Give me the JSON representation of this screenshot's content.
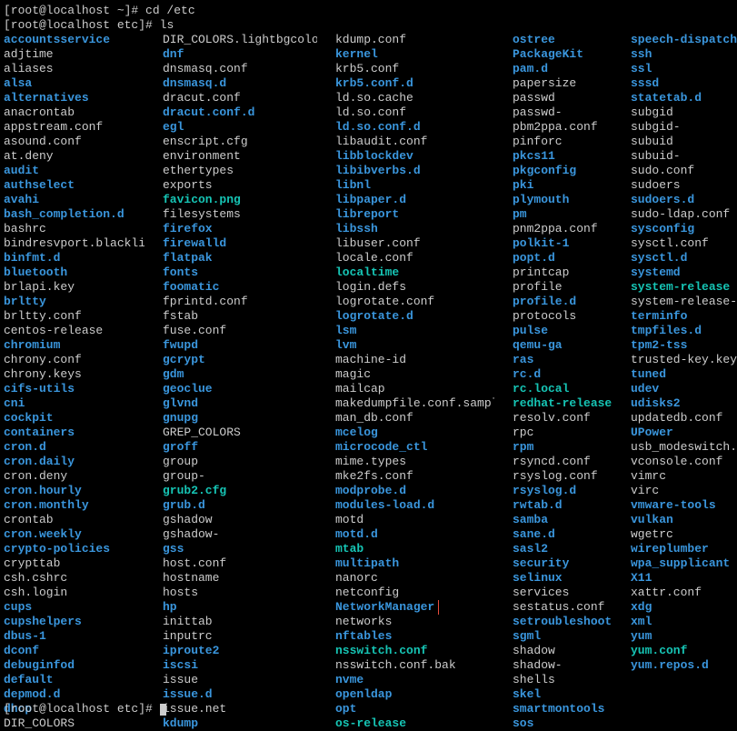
{
  "prompts": {
    "line1": "[root@localhost ~]# ",
    "cmd1": "cd /etc",
    "line2": "[root@localhost etc]# ",
    "cmd2": "ls",
    "line3": "[root@localhost etc]# "
  },
  "columns": [
    [
      {
        "name": "accountsservice",
        "cls": "dir"
      },
      {
        "name": "adjtime",
        "cls": "file"
      },
      {
        "name": "aliases",
        "cls": "file"
      },
      {
        "name": "alsa",
        "cls": "dir"
      },
      {
        "name": "alternatives",
        "cls": "dir"
      },
      {
        "name": "anacrontab",
        "cls": "file"
      },
      {
        "name": "appstream.conf",
        "cls": "file"
      },
      {
        "name": "asound.conf",
        "cls": "file"
      },
      {
        "name": "at.deny",
        "cls": "file"
      },
      {
        "name": "audit",
        "cls": "dir"
      },
      {
        "name": "authselect",
        "cls": "dir"
      },
      {
        "name": "avahi",
        "cls": "dir"
      },
      {
        "name": "bash_completion.d",
        "cls": "dir"
      },
      {
        "name": "bashrc",
        "cls": "file"
      },
      {
        "name": "bindresvport.blacklist",
        "cls": "file"
      },
      {
        "name": "binfmt.d",
        "cls": "dir"
      },
      {
        "name": "bluetooth",
        "cls": "dir"
      },
      {
        "name": "brlapi.key",
        "cls": "file"
      },
      {
        "name": "brltty",
        "cls": "dir"
      },
      {
        "name": "brltty.conf",
        "cls": "file"
      },
      {
        "name": "centos-release",
        "cls": "file"
      },
      {
        "name": "chromium",
        "cls": "dir"
      },
      {
        "name": "chrony.conf",
        "cls": "file"
      },
      {
        "name": "chrony.keys",
        "cls": "file"
      },
      {
        "name": "cifs-utils",
        "cls": "dir"
      },
      {
        "name": "cni",
        "cls": "dir"
      },
      {
        "name": "cockpit",
        "cls": "dir"
      },
      {
        "name": "containers",
        "cls": "dir"
      },
      {
        "name": "cron.d",
        "cls": "dir"
      },
      {
        "name": "cron.daily",
        "cls": "dir"
      },
      {
        "name": "cron.deny",
        "cls": "file"
      },
      {
        "name": "cron.hourly",
        "cls": "dir"
      },
      {
        "name": "cron.monthly",
        "cls": "dir"
      },
      {
        "name": "crontab",
        "cls": "file"
      },
      {
        "name": "cron.weekly",
        "cls": "dir"
      },
      {
        "name": "crypto-policies",
        "cls": "dir"
      },
      {
        "name": "crypttab",
        "cls": "file"
      },
      {
        "name": "csh.cshrc",
        "cls": "file"
      },
      {
        "name": "csh.login",
        "cls": "file"
      },
      {
        "name": "cups",
        "cls": "dir"
      },
      {
        "name": "cupshelpers",
        "cls": "dir"
      },
      {
        "name": "dbus-1",
        "cls": "dir"
      },
      {
        "name": "dconf",
        "cls": "dir"
      },
      {
        "name": "debuginfod",
        "cls": "dir"
      },
      {
        "name": "default",
        "cls": "dir"
      },
      {
        "name": "depmod.d",
        "cls": "dir"
      },
      {
        "name": "dhcp",
        "cls": "dir"
      },
      {
        "name": "DIR_COLORS",
        "cls": "file"
      }
    ],
    [
      {
        "name": "DIR_COLORS.lightbgcolor",
        "cls": "file"
      },
      {
        "name": "dnf",
        "cls": "dir"
      },
      {
        "name": "dnsmasq.conf",
        "cls": "file"
      },
      {
        "name": "dnsmasq.d",
        "cls": "dir"
      },
      {
        "name": "dracut.conf",
        "cls": "file"
      },
      {
        "name": "dracut.conf.d",
        "cls": "dir"
      },
      {
        "name": "egl",
        "cls": "dir"
      },
      {
        "name": "enscript.cfg",
        "cls": "file"
      },
      {
        "name": "environment",
        "cls": "file"
      },
      {
        "name": "ethertypes",
        "cls": "file"
      },
      {
        "name": "exports",
        "cls": "file"
      },
      {
        "name": "favicon.png",
        "cls": "lnk"
      },
      {
        "name": "filesystems",
        "cls": "file"
      },
      {
        "name": "firefox",
        "cls": "dir"
      },
      {
        "name": "firewalld",
        "cls": "dir"
      },
      {
        "name": "flatpak",
        "cls": "dir"
      },
      {
        "name": "fonts",
        "cls": "dir"
      },
      {
        "name": "foomatic",
        "cls": "dir"
      },
      {
        "name": "fprintd.conf",
        "cls": "file"
      },
      {
        "name": "fstab",
        "cls": "file"
      },
      {
        "name": "fuse.conf",
        "cls": "file"
      },
      {
        "name": "fwupd",
        "cls": "dir"
      },
      {
        "name": "gcrypt",
        "cls": "dir"
      },
      {
        "name": "gdm",
        "cls": "dir"
      },
      {
        "name": "geoclue",
        "cls": "dir"
      },
      {
        "name": "glvnd",
        "cls": "dir"
      },
      {
        "name": "gnupg",
        "cls": "dir"
      },
      {
        "name": "GREP_COLORS",
        "cls": "file"
      },
      {
        "name": "groff",
        "cls": "dir"
      },
      {
        "name": "group",
        "cls": "file"
      },
      {
        "name": "group-",
        "cls": "file"
      },
      {
        "name": "grub2.cfg",
        "cls": "lnk"
      },
      {
        "name": "grub.d",
        "cls": "dir"
      },
      {
        "name": "gshadow",
        "cls": "file"
      },
      {
        "name": "gshadow-",
        "cls": "file"
      },
      {
        "name": "gss",
        "cls": "dir"
      },
      {
        "name": "host.conf",
        "cls": "file"
      },
      {
        "name": "hostname",
        "cls": "file"
      },
      {
        "name": "hosts",
        "cls": "file"
      },
      {
        "name": "hp",
        "cls": "dir"
      },
      {
        "name": "inittab",
        "cls": "file"
      },
      {
        "name": "inputrc",
        "cls": "file"
      },
      {
        "name": "iproute2",
        "cls": "dir"
      },
      {
        "name": "iscsi",
        "cls": "dir"
      },
      {
        "name": "issue",
        "cls": "file"
      },
      {
        "name": "issue.d",
        "cls": "dir"
      },
      {
        "name": "issue.net",
        "cls": "file"
      },
      {
        "name": "kdump",
        "cls": "dir"
      }
    ],
    [
      {
        "name": "kdump.conf",
        "cls": "file"
      },
      {
        "name": "kernel",
        "cls": "dir"
      },
      {
        "name": "krb5.conf",
        "cls": "file"
      },
      {
        "name": "krb5.conf.d",
        "cls": "dir"
      },
      {
        "name": "ld.so.cache",
        "cls": "file"
      },
      {
        "name": "ld.so.conf",
        "cls": "file"
      },
      {
        "name": "ld.so.conf.d",
        "cls": "dir"
      },
      {
        "name": "libaudit.conf",
        "cls": "file"
      },
      {
        "name": "libblockdev",
        "cls": "dir"
      },
      {
        "name": "libibverbs.d",
        "cls": "dir"
      },
      {
        "name": "libnl",
        "cls": "dir"
      },
      {
        "name": "libpaper.d",
        "cls": "dir"
      },
      {
        "name": "libreport",
        "cls": "dir"
      },
      {
        "name": "libssh",
        "cls": "dir"
      },
      {
        "name": "libuser.conf",
        "cls": "file"
      },
      {
        "name": "locale.conf",
        "cls": "file"
      },
      {
        "name": "localtime",
        "cls": "lnk"
      },
      {
        "name": "login.defs",
        "cls": "file"
      },
      {
        "name": "logrotate.conf",
        "cls": "file"
      },
      {
        "name": "logrotate.d",
        "cls": "dir"
      },
      {
        "name": "lsm",
        "cls": "dir"
      },
      {
        "name": "lvm",
        "cls": "dir"
      },
      {
        "name": "machine-id",
        "cls": "file"
      },
      {
        "name": "magic",
        "cls": "file"
      },
      {
        "name": "mailcap",
        "cls": "file"
      },
      {
        "name": "makedumpfile.conf.sample",
        "cls": "file"
      },
      {
        "name": "man_db.conf",
        "cls": "file"
      },
      {
        "name": "mcelog",
        "cls": "dir"
      },
      {
        "name": "microcode_ctl",
        "cls": "dir"
      },
      {
        "name": "mime.types",
        "cls": "file"
      },
      {
        "name": "mke2fs.conf",
        "cls": "file"
      },
      {
        "name": "modprobe.d",
        "cls": "dir"
      },
      {
        "name": "modules-load.d",
        "cls": "dir"
      },
      {
        "name": "motd",
        "cls": "file"
      },
      {
        "name": "motd.d",
        "cls": "dir"
      },
      {
        "name": "mtab",
        "cls": "lnk"
      },
      {
        "name": "multipath",
        "cls": "dir"
      },
      {
        "name": "nanorc",
        "cls": "file"
      },
      {
        "name": "netconfig",
        "cls": "file"
      },
      {
        "name": "NetworkManager",
        "cls": "dir",
        "hl": true
      },
      {
        "name": "networks",
        "cls": "file"
      },
      {
        "name": "nftables",
        "cls": "dir"
      },
      {
        "name": "nsswitch.conf",
        "cls": "lnk"
      },
      {
        "name": "nsswitch.conf.bak",
        "cls": "file"
      },
      {
        "name": "nvme",
        "cls": "dir"
      },
      {
        "name": "openldap",
        "cls": "dir"
      },
      {
        "name": "opt",
        "cls": "dir"
      },
      {
        "name": "os-release",
        "cls": "lnk"
      }
    ],
    [
      {
        "name": "ostree",
        "cls": "dir"
      },
      {
        "name": "PackageKit",
        "cls": "dir"
      },
      {
        "name": "pam.d",
        "cls": "dir"
      },
      {
        "name": "papersize",
        "cls": "file"
      },
      {
        "name": "passwd",
        "cls": "file"
      },
      {
        "name": "passwd-",
        "cls": "file"
      },
      {
        "name": "pbm2ppa.conf",
        "cls": "file"
      },
      {
        "name": "pinforc",
        "cls": "file"
      },
      {
        "name": "pkcs11",
        "cls": "dir"
      },
      {
        "name": "pkgconfig",
        "cls": "dir"
      },
      {
        "name": "pki",
        "cls": "dir"
      },
      {
        "name": "plymouth",
        "cls": "dir"
      },
      {
        "name": "pm",
        "cls": "dir"
      },
      {
        "name": "pnm2ppa.conf",
        "cls": "file"
      },
      {
        "name": "polkit-1",
        "cls": "dir"
      },
      {
        "name": "popt.d",
        "cls": "dir"
      },
      {
        "name": "printcap",
        "cls": "file"
      },
      {
        "name": "profile",
        "cls": "file"
      },
      {
        "name": "profile.d",
        "cls": "dir"
      },
      {
        "name": "protocols",
        "cls": "file"
      },
      {
        "name": "pulse",
        "cls": "dir"
      },
      {
        "name": "qemu-ga",
        "cls": "dir"
      },
      {
        "name": "ras",
        "cls": "dir"
      },
      {
        "name": "rc.d",
        "cls": "dir"
      },
      {
        "name": "rc.local",
        "cls": "lnk"
      },
      {
        "name": "redhat-release",
        "cls": "lnk"
      },
      {
        "name": "resolv.conf",
        "cls": "file"
      },
      {
        "name": "rpc",
        "cls": "file"
      },
      {
        "name": "rpm",
        "cls": "dir"
      },
      {
        "name": "rsyncd.conf",
        "cls": "file"
      },
      {
        "name": "rsyslog.conf",
        "cls": "file"
      },
      {
        "name": "rsyslog.d",
        "cls": "dir"
      },
      {
        "name": "rwtab.d",
        "cls": "dir"
      },
      {
        "name": "samba",
        "cls": "dir"
      },
      {
        "name": "sane.d",
        "cls": "dir"
      },
      {
        "name": "sasl2",
        "cls": "dir"
      },
      {
        "name": "security",
        "cls": "dir"
      },
      {
        "name": "selinux",
        "cls": "dir"
      },
      {
        "name": "services",
        "cls": "file"
      },
      {
        "name": "sestatus.conf",
        "cls": "file"
      },
      {
        "name": "setroubleshoot",
        "cls": "dir"
      },
      {
        "name": "sgml",
        "cls": "dir"
      },
      {
        "name": "shadow",
        "cls": "file"
      },
      {
        "name": "shadow-",
        "cls": "file"
      },
      {
        "name": "shells",
        "cls": "file"
      },
      {
        "name": "skel",
        "cls": "dir"
      },
      {
        "name": "smartmontools",
        "cls": "dir"
      },
      {
        "name": "sos",
        "cls": "dir"
      }
    ],
    [
      {
        "name": "speech-dispatcher",
        "cls": "dir"
      },
      {
        "name": "ssh",
        "cls": "dir"
      },
      {
        "name": "ssl",
        "cls": "dir"
      },
      {
        "name": "sssd",
        "cls": "dir"
      },
      {
        "name": "statetab.d",
        "cls": "dir"
      },
      {
        "name": "subgid",
        "cls": "file"
      },
      {
        "name": "subgid-",
        "cls": "file"
      },
      {
        "name": "subuid",
        "cls": "file"
      },
      {
        "name": "subuid-",
        "cls": "file"
      },
      {
        "name": "sudo.conf",
        "cls": "file"
      },
      {
        "name": "sudoers",
        "cls": "file"
      },
      {
        "name": "sudoers.d",
        "cls": "dir"
      },
      {
        "name": "sudo-ldap.conf",
        "cls": "file"
      },
      {
        "name": "sysconfig",
        "cls": "dir"
      },
      {
        "name": "sysctl.conf",
        "cls": "file"
      },
      {
        "name": "sysctl.d",
        "cls": "dir"
      },
      {
        "name": "systemd",
        "cls": "dir"
      },
      {
        "name": "system-release",
        "cls": "lnk"
      },
      {
        "name": "system-release-cpe",
        "cls": "file"
      },
      {
        "name": "terminfo",
        "cls": "dir"
      },
      {
        "name": "tmpfiles.d",
        "cls": "dir"
      },
      {
        "name": "tpm2-tss",
        "cls": "dir"
      },
      {
        "name": "trusted-key.key",
        "cls": "file"
      },
      {
        "name": "tuned",
        "cls": "dir"
      },
      {
        "name": "udev",
        "cls": "dir"
      },
      {
        "name": "udisks2",
        "cls": "dir"
      },
      {
        "name": "updatedb.conf",
        "cls": "file"
      },
      {
        "name": "UPower",
        "cls": "dir"
      },
      {
        "name": "usb_modeswitch.conf",
        "cls": "file"
      },
      {
        "name": "vconsole.conf",
        "cls": "file"
      },
      {
        "name": "vimrc",
        "cls": "file"
      },
      {
        "name": "virc",
        "cls": "file"
      },
      {
        "name": "vmware-tools",
        "cls": "dir"
      },
      {
        "name": "vulkan",
        "cls": "dir"
      },
      {
        "name": "wgetrc",
        "cls": "file"
      },
      {
        "name": "wireplumber",
        "cls": "dir"
      },
      {
        "name": "wpa_supplicant",
        "cls": "dir"
      },
      {
        "name": "X11",
        "cls": "dir"
      },
      {
        "name": "xattr.conf",
        "cls": "file"
      },
      {
        "name": "xdg",
        "cls": "dir"
      },
      {
        "name": "xml",
        "cls": "dir"
      },
      {
        "name": "yum",
        "cls": "dir"
      },
      {
        "name": "yum.conf",
        "cls": "lnk"
      },
      {
        "name": "yum.repos.d",
        "cls": "dir"
      }
    ]
  ]
}
